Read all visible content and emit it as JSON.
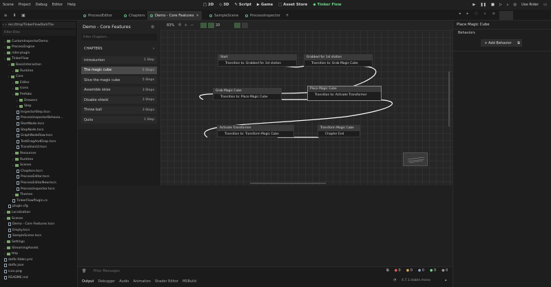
{
  "menu": [
    "Scene",
    "Project",
    "Debug",
    "Editor",
    "Help"
  ],
  "toolbar": {
    "mode_2d": "2D",
    "mode_3d": "3D",
    "script": "Script",
    "game": "Game",
    "asset_store": "Asset Store",
    "tinker_flow": "Tinker Flow",
    "use_rider": "Use Rider"
  },
  "tabs": [
    {
      "label": "ProcessEditor",
      "active": false
    },
    {
      "label": "Chapters",
      "active": false
    },
    {
      "label": "Demo - Core Features",
      "active": true
    },
    {
      "label": "SampleScene",
      "active": false
    },
    {
      "label": "ProcessInspector",
      "active": false
    }
  ],
  "file_panel": {
    "path": "res://tmp/TinkerFlowDarkThe",
    "filter_placeholder": "Filter Files",
    "rows": [
      {
        "label": "CustomInspectorDemo",
        "depth": 1,
        "kind": "folder"
      },
      {
        "label": "ProcessEngine",
        "depth": 1,
        "kind": "folder"
      },
      {
        "label": "rider-plugin",
        "depth": 1,
        "kind": "folder"
      },
      {
        "label": "TinkerFlow",
        "depth": 1,
        "kind": "folder"
      },
      {
        "label": "BasicInteraction",
        "depth": 2,
        "kind": "folder"
      },
      {
        "label": "Runtime",
        "depth": 3,
        "kind": "folder"
      },
      {
        "label": "Core",
        "depth": 2,
        "kind": "folder"
      },
      {
        "label": "Editor",
        "depth": 3,
        "kind": "folder"
      },
      {
        "label": "Icons",
        "depth": 3,
        "kind": "folder"
      },
      {
        "label": "Prefabs",
        "depth": 3,
        "kind": "folder"
      },
      {
        "label": "Drawers",
        "depth": 4,
        "kind": "folder"
      },
      {
        "label": "Step",
        "depth": 4,
        "kind": "folder"
      },
      {
        "label": "InspectorStep.tscn",
        "depth": 4,
        "kind": "file"
      },
      {
        "label": "ProcessInspectorBehavio...",
        "depth": 4,
        "kind": "file"
      },
      {
        "label": "StartNode.tscn",
        "depth": 4,
        "kind": "file"
      },
      {
        "label": "StepNode.tscn",
        "depth": 4,
        "kind": "file"
      },
      {
        "label": "GraphNodeRow.tscn",
        "depth": 4,
        "kind": "file"
      },
      {
        "label": "TestDragAndDrop.tscn",
        "depth": 4,
        "kind": "file"
      },
      {
        "label": "TransitionUI.tscn",
        "depth": 4,
        "kind": "file"
      },
      {
        "label": "Resources",
        "depth": 3,
        "kind": "folder"
      },
      {
        "label": "Runtime",
        "depth": 3,
        "kind": "folder"
      },
      {
        "label": "Scenes",
        "depth": 3,
        "kind": "folder"
      },
      {
        "label": "Chapters.tscn",
        "depth": 4,
        "kind": "file"
      },
      {
        "label": "ProcessEditor.tscn",
        "depth": 4,
        "kind": "file"
      },
      {
        "label": "ProcessEditorNew.tscn",
        "depth": 4,
        "kind": "file"
      },
      {
        "label": "ProcessInspector.tscn",
        "depth": 4,
        "kind": "file"
      },
      {
        "label": "Themes",
        "depth": 3,
        "kind": "folder"
      },
      {
        "label": "TinkerFlowPlugin.cs",
        "depth": 3,
        "kind": "file"
      },
      {
        "label": "plugin.cfg",
        "depth": 2,
        "kind": "file"
      },
      {
        "label": "Localization",
        "depth": 1,
        "kind": "folder"
      },
      {
        "label": "Scenes",
        "depth": 1,
        "kind": "folder"
      },
      {
        "label": "Demo - Core Features.tscn",
        "depth": 2,
        "kind": "file"
      },
      {
        "label": "Empty.tscn",
        "depth": 2,
        "kind": "file"
      },
      {
        "label": "SampleScene.tscn",
        "depth": 2,
        "kind": "file"
      },
      {
        "label": "Settings",
        "depth": 1,
        "kind": "folder"
      },
      {
        "label": "StreamingAssets",
        "depth": 1,
        "kind": "folder"
      },
      {
        "label": "tmp",
        "depth": 1,
        "kind": "folder"
      },
      {
        "label": "dotfx.fdder.yml",
        "depth": 1,
        "kind": "file"
      },
      {
        "label": "dotfx.json",
        "depth": 1,
        "kind": "file"
      },
      {
        "label": "icon.png",
        "depth": 1,
        "kind": "file"
      },
      {
        "label": "README.md",
        "depth": 1,
        "kind": "file"
      }
    ]
  },
  "chapters": {
    "title": "Demo - Core Features",
    "filter_placeholder": "Filter Chapters...",
    "header": "CHAPTERS",
    "items": [
      {
        "label": "Introduction",
        "steps": "1 Step",
        "selected": false
      },
      {
        "label": "The magic cube",
        "steps": "5 Steps",
        "selected": true
      },
      {
        "label": "Slice the magic cube",
        "steps": "5 Steps",
        "selected": false
      },
      {
        "label": "Assemble skies",
        "steps": "3 Steps",
        "selected": false
      },
      {
        "label": "Disable shield",
        "steps": "3 Steps",
        "selected": false
      },
      {
        "label": "Throw ball",
        "steps": "3 Steps",
        "selected": false
      },
      {
        "label": "Quits",
        "steps": "1 Step",
        "selected": false
      }
    ]
  },
  "graph": {
    "zoom": "83%",
    "snap": "20",
    "nodes": [
      {
        "header": "Start",
        "body": "Transition to: Grabbed for 1st station"
      },
      {
        "header": "Grabbed for 1st station",
        "body": "Transition to: Grab Magic Cube"
      },
      {
        "header": "Grab Magic Cube",
        "body": "Transition to: Place Magic Cube"
      },
      {
        "header": "Place Magic Cube",
        "body": "Transition to: Activate Transformer"
      },
      {
        "header": "Activate Transformer",
        "body": "Transition to: Transform Magic Cube"
      },
      {
        "header": "Transform Magic Cube",
        "body": "Chapter End"
      }
    ]
  },
  "inspector": {
    "title": "Place Magic Cube",
    "section": "Behaviors",
    "add_behavior": "+ Add Behavior"
  },
  "console": {
    "filter_placeholder": "Filter Messages",
    "counts": [
      "0",
      "0",
      "0",
      "0",
      "0"
    ],
    "version": "4.7.1.stable.mono"
  },
  "bottom_tabs": [
    "Output",
    "Debugger",
    "Audio",
    "Animation",
    "Shader Editor",
    "MSBuild"
  ],
  "colors": {
    "accent_green": "#6fd68a",
    "panel_bg": "#232323",
    "graph_bg": "#262626",
    "selected_row": "#4a4a4a"
  }
}
